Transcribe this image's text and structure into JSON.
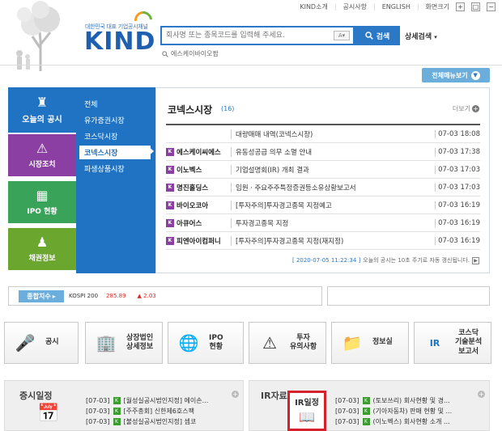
{
  "header": {
    "top_links": [
      "KIND소개",
      "공시사항",
      "ENGLISH",
      "화면크기"
    ],
    "logo_sub": "대한민국 대표 기업공시채널",
    "logo": "KIND",
    "search_placeholder": "회사명 또는 종목코드를 입력해 주세요.",
    "search_button": "검색",
    "advanced_search": "상세검색",
    "recent_search": "에스케이바이오팜",
    "all_menu": "전체메뉴보기"
  },
  "left_tabs": [
    {
      "label": "오늘의 공시",
      "color": "#1f73c2"
    },
    {
      "label": "시장조치",
      "color": "#8b3fa3"
    },
    {
      "label": "IPO 현황",
      "color": "#3aa35a"
    },
    {
      "label": "채권정보",
      "color": "#6ba72f"
    }
  ],
  "submenu": [
    "전체",
    "유가증권시장",
    "코스닥시장",
    "코넥스시장",
    "파생상품시장"
  ],
  "panel": {
    "title": "코넥스시장",
    "count": "(16)",
    "more": "더보기",
    "rows": [
      {
        "corp": "",
        "title": "대량매매 내역(코넥스시장)",
        "time": "07-03 18:08"
      },
      {
        "corp": "에스케이씨에스",
        "title": "유동성공급 의무 소멸 안내",
        "time": "07-03 17:38"
      },
      {
        "corp": "이노벡스",
        "title": "기업설명회(IR) 개최 결과",
        "time": "07-03 17:03"
      },
      {
        "corp": "명진홀딩스",
        "title": "임원ㆍ주요주주특정증권등소유상황보고서",
        "time": "07-03 17:03"
      },
      {
        "corp": "바이오코아",
        "title": "[투자주의]투자경고종목 지정예고",
        "time": "07-03 16:19"
      },
      {
        "corp": "아큐어스",
        "title": "투자경고종목 지정",
        "time": "07-03 16:19"
      },
      {
        "corp": "피엔아이컴퍼니",
        "title": "[투자주의]투자경고종목 지정(재지정)",
        "time": "07-03 16:19"
      }
    ],
    "timestamp": "[ 2020-07-05 11:22:34 ]",
    "refresh_note": "오늘의 공시는 10초 주기로 자동 갱신됩니다."
  },
  "index": {
    "label": "종합지수",
    "name": "KOSPI 200",
    "value": "285.89",
    "change": "2.03"
  },
  "quick_menu": [
    {
      "label": "공시"
    },
    {
      "label": "상장법인\n상세정보"
    },
    {
      "label": "IPO\n현황"
    },
    {
      "label": "투자\n유의사항"
    },
    {
      "label": "정보실"
    },
    {
      "label": "코스닥\n기술분석\n보고서"
    }
  ],
  "schedule": {
    "title": "증시일정",
    "items": [
      {
        "date": "[07-03]",
        "text": "[월성실공시법인지정] 에이손..."
      },
      {
        "date": "[07-03]",
        "text": "[주주총회] 신한제6호스팩"
      },
      {
        "date": "[07-03]",
        "text": "[불성실공시법인지정] 셈코"
      }
    ]
  },
  "ir": {
    "title": "IR자료실",
    "highlight": "IR일정",
    "items": [
      {
        "date": "[07-03]",
        "text": "(토보쓰리) 회사현황 및 경..."
      },
      {
        "date": "[07-03]",
        "text": "(기아자동차) 판매 현황 및 ..."
      },
      {
        "date": "[07-03]",
        "text": "(이노벡스) 회사현황 소개 ..."
      }
    ]
  }
}
